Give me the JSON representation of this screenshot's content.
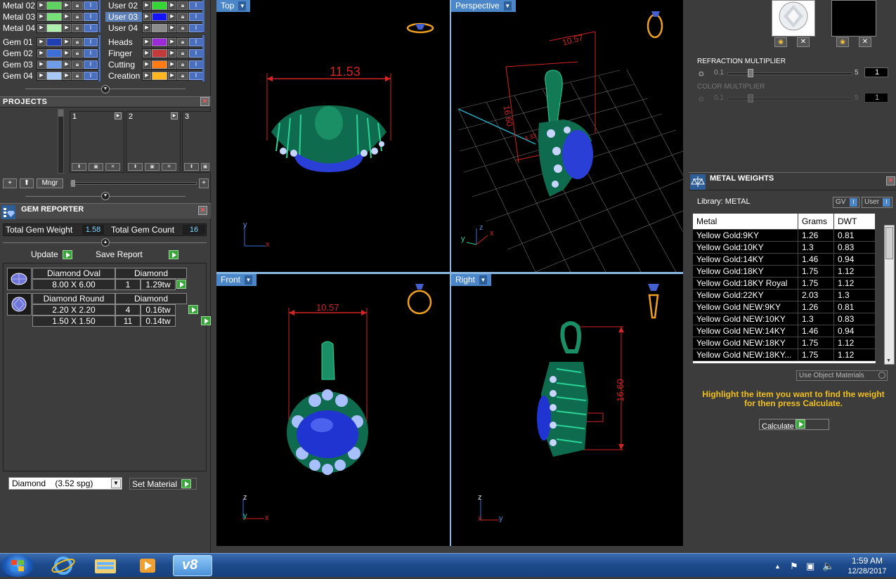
{
  "layers": {
    "left_col": [
      {
        "label": "Metal 02",
        "color": "#5fd35f"
      },
      {
        "label": "Metal 03",
        "color": "#77e077"
      },
      {
        "label": "Metal 04",
        "color": "#aef0ae"
      },
      {
        "label": "Gem 01",
        "color": "#1f3fb3"
      },
      {
        "label": "Gem 02",
        "color": "#3d6fd6"
      },
      {
        "label": "Gem 03",
        "color": "#6f9ce8"
      },
      {
        "label": "Gem 04",
        "color": "#a7c7f5"
      }
    ],
    "right_col": [
      {
        "label": "User 02",
        "color": "#35d735"
      },
      {
        "label": "User 03",
        "color": "#1414ff",
        "selected": true
      },
      {
        "label": "User 04",
        "color": "#8c8c8c"
      },
      {
        "label": "Heads",
        "color": "#9b2bd6"
      },
      {
        "label": "Finger",
        "color": "#c23b3b"
      },
      {
        "label": "Cutting",
        "color": "#ff7a12"
      },
      {
        "label": "Creation",
        "color": "#ffb61f"
      }
    ]
  },
  "projects": {
    "title": "PROJECTS",
    "slots": [
      "1",
      "2",
      "3"
    ],
    "mngr_label": "Mngr"
  },
  "gem_reporter": {
    "title": "GEM REPORTER",
    "total_weight_label": "Total Gem Weight",
    "total_weight_value": "1.58",
    "total_count_label": "Total Gem Count",
    "total_count_value": "16",
    "update_label": "Update",
    "save_report_label": "Save Report",
    "gems": [
      {
        "shape": "Diamond Oval",
        "material": "Diamond",
        "rows": [
          {
            "size": "8.00 X 6.00",
            "count": "1",
            "weight": "1.29tw"
          }
        ]
      },
      {
        "shape": "Diamond Round",
        "material": "Diamond",
        "rows": [
          {
            "size": "2.20 X 2.20",
            "count": "4",
            "weight": "0.16tw"
          },
          {
            "size": "1.50 X 1.50",
            "count": "11",
            "weight": "0.14tw"
          }
        ]
      }
    ],
    "material_select": "Diamond    (3.52 spg)",
    "set_material_label": "Set Material"
  },
  "viewports": {
    "top": {
      "label": "Top",
      "dimension": "11.53",
      "axis1": "y",
      "axis2": "x"
    },
    "perspective": {
      "label": "Perspective",
      "dimension1": "10.57",
      "dimension2": "16.60",
      "dimension3": "4.33",
      "axis1": "z",
      "axis2": "y",
      "axis3": "x"
    },
    "front": {
      "label": "Front",
      "dimension": "10.57",
      "axis1": "z",
      "axis2": "y",
      "axis3": "x"
    },
    "right": {
      "label": "Right",
      "dimension": "16.60",
      "axis1": "z",
      "axis2": "x",
      "axis3": "y"
    }
  },
  "render": {
    "refraction_label": "REFRACTION MULTIPLIER",
    "refraction_min": "0.1",
    "refraction_max": "5",
    "refraction_value": "1",
    "color_label": "COLOR MULTIPLIER",
    "color_min": "0.1",
    "color_max": "5",
    "color_value": "1"
  },
  "metal_weights": {
    "title": "METAL WEIGHTS",
    "library_label": "Library: METAL",
    "gv_label": "GV",
    "user_label": "User",
    "columns": [
      "Metal",
      "Grams",
      "DWT"
    ],
    "rows": [
      [
        "Yellow Gold:9KY",
        "1.26",
        "0.81"
      ],
      [
        "Yellow Gold:10KY",
        "1.3",
        "0.83"
      ],
      [
        "Yellow Gold:14KY",
        "1.46",
        "0.94"
      ],
      [
        "Yellow Gold:18KY",
        "1.75",
        "1.12"
      ],
      [
        "Yellow Gold:18KY Royal",
        "1.75",
        "1.12"
      ],
      [
        "Yellow Gold:22KY",
        "2.03",
        "1.3"
      ],
      [
        "Yellow Gold NEW:9KY",
        "1.26",
        "0.81"
      ],
      [
        "Yellow Gold NEW:10KY",
        "1.3",
        "0.83"
      ],
      [
        "Yellow Gold NEW:14KY",
        "1.46",
        "0.94"
      ],
      [
        "Yellow Gold NEW:18KY",
        "1.75",
        "1.12"
      ],
      [
        "Yellow Gold NEW:18KY...",
        "1.75",
        "1.12"
      ]
    ],
    "use_object_label": "Use Object Materials",
    "hint": "Highlight the item you want to find the weight for then press Calculate.",
    "calculate_label": "Calculate"
  },
  "taskbar": {
    "time": "1:59 AM",
    "date": "12/28/2017",
    "apps": [
      "windows-start",
      "internet-explorer",
      "file-explorer",
      "media-player",
      "v8"
    ]
  }
}
